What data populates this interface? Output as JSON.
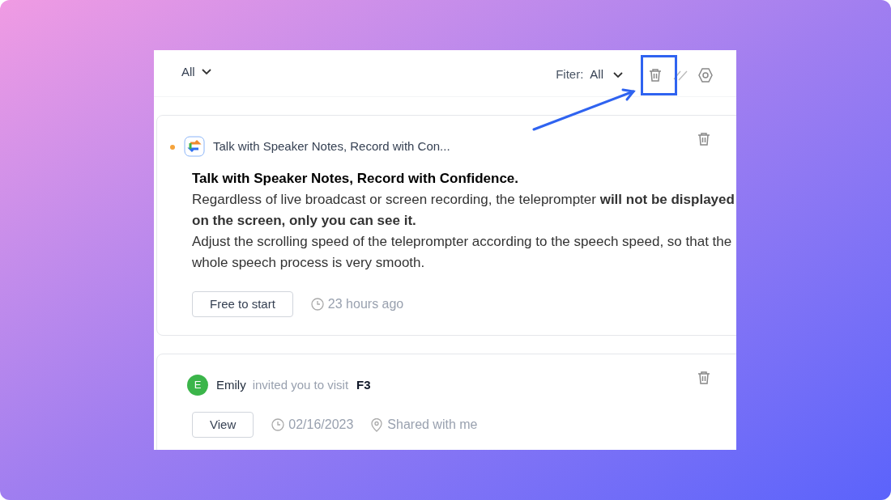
{
  "header": {
    "scope": "All",
    "filter_label": "Fiter:",
    "filter_value": "All"
  },
  "notifications": [
    {
      "kind": "promo",
      "unread": true,
      "title": "Talk with Speaker Notes, Record with Con...",
      "headline": "Talk with Speaker Notes, Record with Confidence.",
      "paragraphs": [
        "Regardless of live broadcast or screen recording, the teleprompter **will not be displayed on the screen, only you can see it.**",
        "Adjust the scrolling speed of the teleprompter according to the speech speed, so that the whole speech process is very smooth."
      ],
      "action": "Free to start",
      "time": "23 hours ago"
    },
    {
      "kind": "invite",
      "unread": false,
      "avatar": "E",
      "color": "#3bb54a",
      "sender": "Emily",
      "message": "invited you to visit",
      "target": "F3",
      "action": "View",
      "time": "02/16/2023",
      "location": "Shared with me"
    }
  ]
}
